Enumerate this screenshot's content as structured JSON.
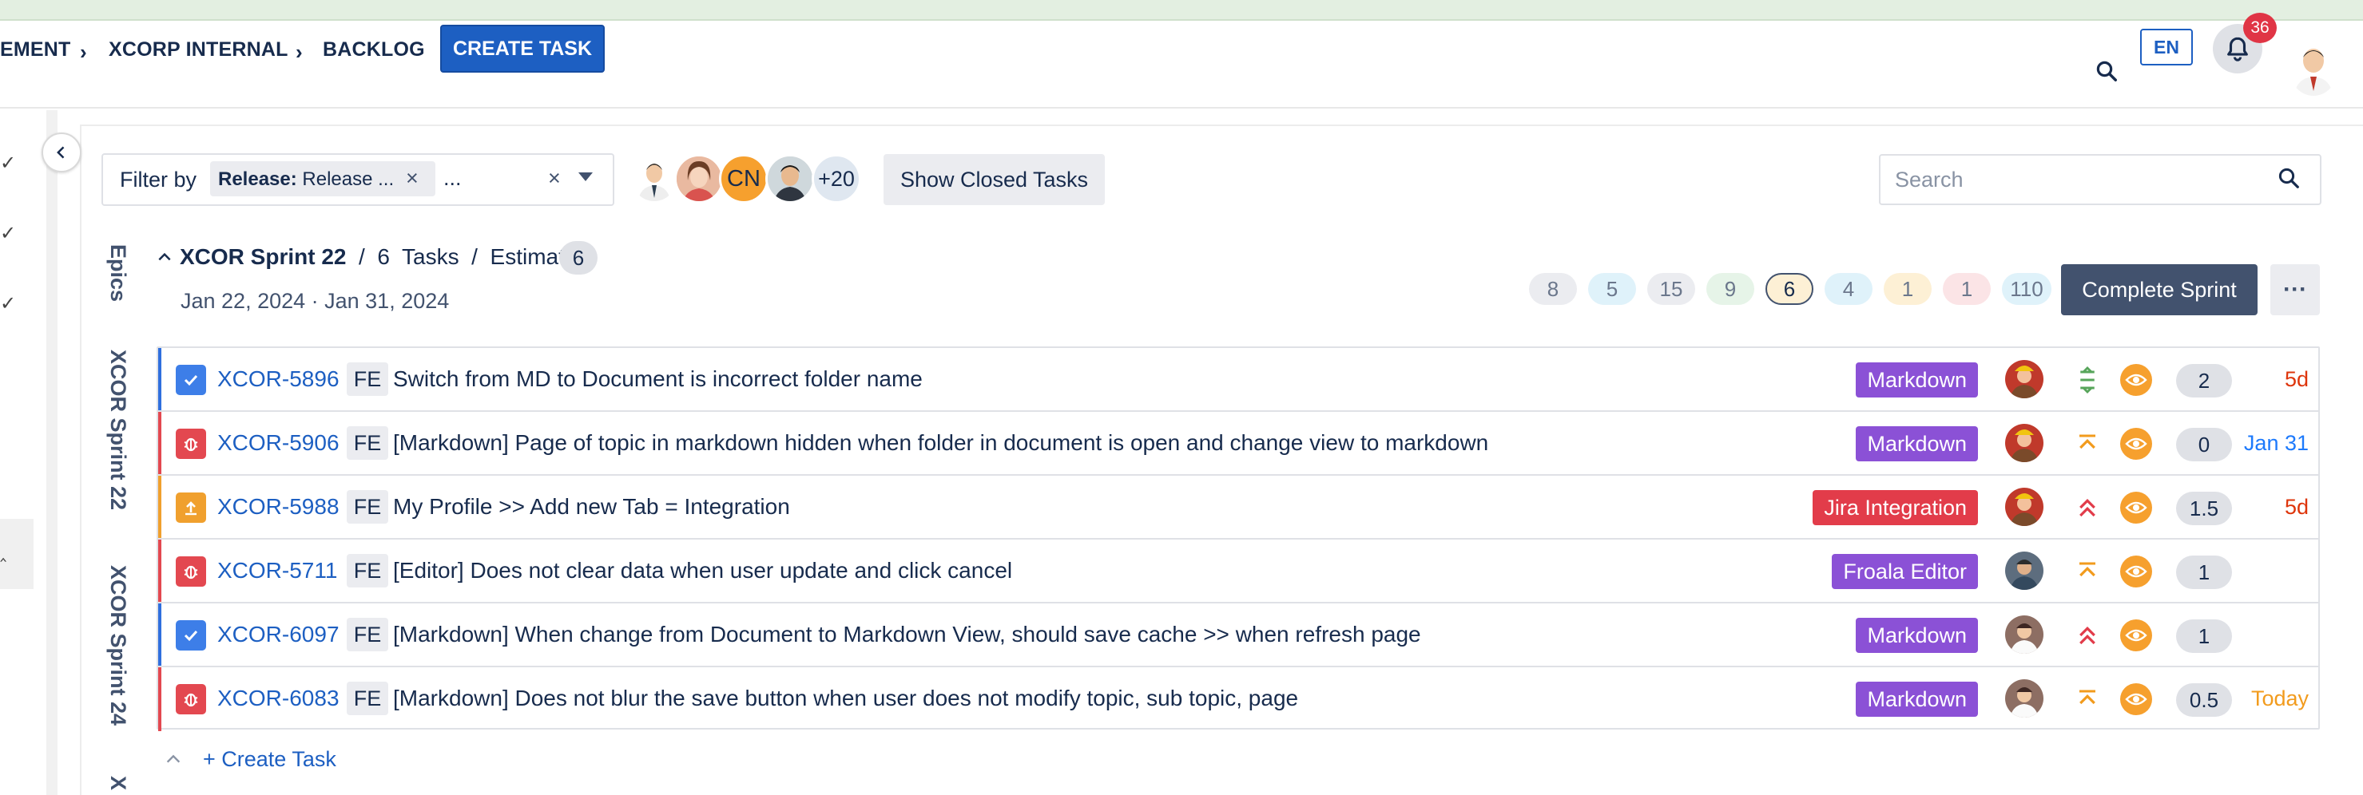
{
  "header": {
    "breadcrumbs": [
      "EMENT",
      "XCORP INTERNAL",
      "BACKLOG"
    ],
    "create_task_label": "CREATE TASK",
    "language": "EN",
    "notification_count": "36"
  },
  "filter": {
    "label": "Filter by",
    "chip_key": "Release:",
    "chip_value": " Release ...",
    "overflow": "..."
  },
  "members": {
    "initials": "CN",
    "more": "+20"
  },
  "show_closed_label": "Show Closed Tasks",
  "search": {
    "placeholder": "Search"
  },
  "side_labels": {
    "epics": "Epics",
    "sprint22": "XCOR Sprint 22",
    "sprint24": "XCOR Sprint 24",
    "next": "X"
  },
  "sprint": {
    "name": "XCOR Sprint 22",
    "task_count": "6",
    "tasks_word": "Tasks",
    "estimate_word": "Estimate",
    "estimate_count": "6",
    "dates": "Jan 22, 2024 · Jan 31, 2024",
    "stats": [
      {
        "value": "8",
        "color": "#ebecf0"
      },
      {
        "value": "5",
        "color": "#e0f3fb"
      },
      {
        "value": "15",
        "color": "#ebecf0"
      },
      {
        "value": "9",
        "color": "#e8f4ea"
      },
      {
        "value": "6",
        "color": "#fdf0d5"
      },
      {
        "value": "4",
        "color": "#e0f3fb"
      },
      {
        "value": "1",
        "color": "#fdf0d5"
      },
      {
        "value": "1",
        "color": "#fbe4e6"
      },
      {
        "value": "110",
        "color": "#e0f3fb"
      }
    ],
    "complete_label": "Complete Sprint",
    "more_label": "···"
  },
  "tasks": [
    {
      "key": "XCOR-5896",
      "type": "task",
      "team": "FE",
      "summary": "Switch from MD to Document is incorrect folder name",
      "tag": "Markdown",
      "tag_color": "#8b51d6",
      "priority": "medium",
      "points": "2",
      "due": "5d",
      "due_color": "#de350b",
      "bar_color": "#2f6fde"
    },
    {
      "key": "XCOR-5906",
      "type": "bug",
      "team": "FE",
      "summary": "[Markdown] Page of topic in markdown hidden when folder in document is open and change view to markdown",
      "tag": "Markdown",
      "tag_color": "#8b51d6",
      "priority": "high",
      "points": "0",
      "due": "Jan 31",
      "due_color": "#1d7afc",
      "bar_color": "#e34850"
    },
    {
      "key": "XCOR-5988",
      "type": "improvement",
      "team": "FE",
      "summary": "My Profile >> Add new Tab = Integration",
      "tag": "Jira Integration",
      "tag_color": "#e23c4a",
      "priority": "highest",
      "points": "1.5",
      "due": "5d",
      "due_color": "#de350b",
      "bar_color": "#f0a02e"
    },
    {
      "key": "XCOR-5711",
      "type": "bug",
      "team": "FE",
      "summary": "[Editor] Does not clear data when user update and click cancel",
      "tag": "Froala Editor",
      "tag_color": "#8b51d6",
      "priority": "high",
      "points": "1",
      "due": "",
      "due_color": "#de350b",
      "bar_color": "#e34850"
    },
    {
      "key": "XCOR-6097",
      "type": "task",
      "team": "FE",
      "summary": "[Markdown] When change from Document to Markdown View, should save cache >> when refresh page",
      "tag": "Markdown",
      "tag_color": "#8b51d6",
      "priority": "highest",
      "points": "1",
      "due": "",
      "due_color": "#de350b",
      "bar_color": "#2f6fde"
    },
    {
      "key": "XCOR-6083",
      "type": "bug",
      "team": "FE",
      "summary": "[Markdown] Does not blur the save button when user does not modify topic, sub topic, page",
      "tag": "Markdown",
      "tag_color": "#8b51d6",
      "priority": "high",
      "points": "0.5",
      "due": "Today",
      "due_color": "#f29b1d",
      "bar_color": "#e34850"
    }
  ],
  "create_task_row_label": "+ Create Task"
}
